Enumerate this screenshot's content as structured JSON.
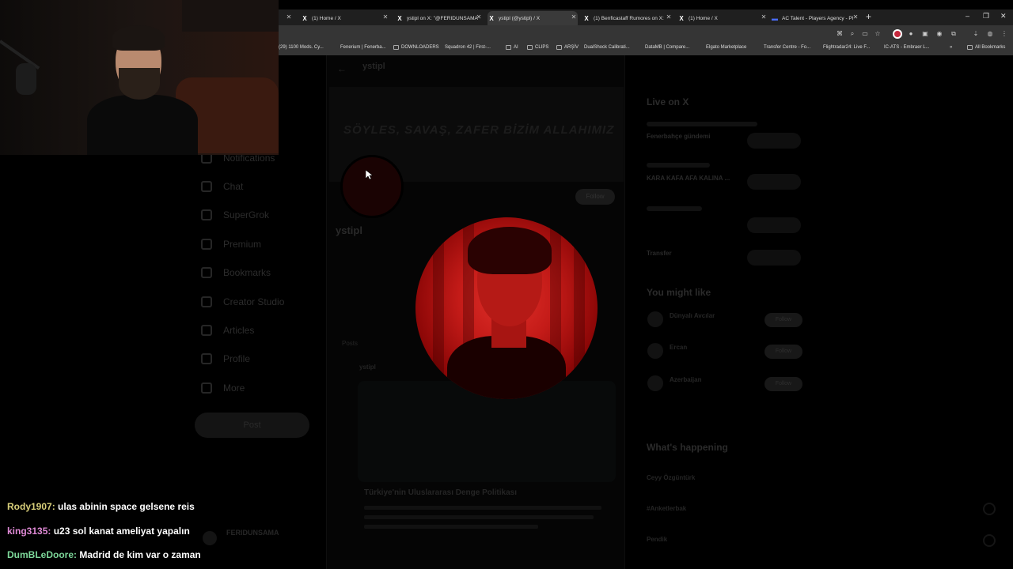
{
  "browser": {
    "tabs": [
      {
        "title": "(1) Home / X",
        "active": false
      },
      {
        "title": "ystipl on X: \"@FERIDUNSAMA",
        "active": false
      },
      {
        "title": "ystipl (@ystipl) / X",
        "active": true
      },
      {
        "title": "(1) Benficastaff Rumores on X:",
        "active": false
      },
      {
        "title": "(1) Home / X",
        "active": false
      },
      {
        "title": "AC Talent - Players Agency - Pl",
        "active": false
      }
    ],
    "bookmarks": [
      "(29) 1100 Mods. Cy...",
      "Fenerium | Fenerba...",
      "DOWNLOADERS",
      "Squadron 42 | First-...",
      "AI",
      "CLIPS",
      "ARŞİV",
      "DualShock Calibrati...",
      "DataMB | Compare...",
      "Elgato Marketplace",
      "Transfer Centre - Fo...",
      "Flightradar24: Live F...",
      "IC-ATS - Embraer L...",
      "All Bookmarks"
    ]
  },
  "profile": {
    "header_handle": "ystipl",
    "name": "ystipl",
    "banner_text": "SÖYLES, SAVAŞ, ZAFER BİZİM ALLAHIMIZ",
    "follow_label": "Follow",
    "posts_tab": "Posts"
  },
  "sidebar": {
    "items": [
      "Notifications",
      "Chat",
      "SuperGrok",
      "Premium",
      "Bookmarks",
      "Creator Studio",
      "Articles",
      "Profile",
      "More"
    ],
    "post_button": "Post",
    "account_name": "FERIDUNSAMA"
  },
  "right": {
    "live_heading": "Live on X",
    "live_items": [
      "Fenerbahçe gündemi",
      "KARA KAFA AFA KALINA ...",
      "Transfer"
    ],
    "you_might_like": "You might like",
    "suggestions": [
      "Dünyalı Avcılar",
      "Ercan",
      "Azerbaijan"
    ],
    "follow_label": "Follow",
    "whats_happening": "What's happening",
    "trends": [
      "Ceyy Özgüntürk",
      "#Anketlerbak",
      "Pendik"
    ]
  },
  "feed": {
    "post_title": "Türkiye'nin Uluslararası Denge Politikası"
  },
  "chat": [
    {
      "user": "Rody1907:",
      "message": "ulas abinin space gelsene reis"
    },
    {
      "user": "king3135:",
      "message": "u23 sol kanat ameliyat yapalın"
    },
    {
      "user": "DumBLeDoore:",
      "message": "Madrid de kim var o zaman"
    }
  ]
}
